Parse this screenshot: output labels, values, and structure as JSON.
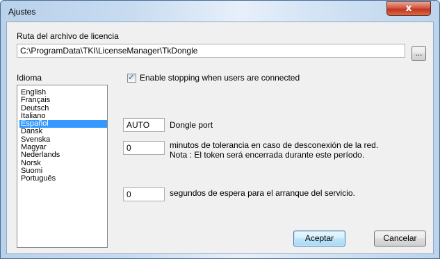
{
  "window": {
    "title": "Ajustes",
    "close_icon": "x-icon",
    "close_label": "x"
  },
  "license": {
    "label": "Ruta del archivo de licencia",
    "path": "C:\\ProgramData\\TKI\\LicenseManager\\TkDongle",
    "browse_label": "..."
  },
  "language": {
    "label": "Idioma",
    "items": [
      "English",
      "Français",
      "Deutsch",
      "Italiano",
      "Español",
      "Dansk",
      "Svenska",
      "Magyar",
      "Nederlands",
      "Norsk",
      "Suomi",
      "Português"
    ],
    "selected": "Español"
  },
  "stopping": {
    "checked": true,
    "label": "Enable stopping when users are connected"
  },
  "dongle": {
    "value": "AUTO",
    "label": "Dongle port"
  },
  "tolerance": {
    "value": "0",
    "line1": "minutos de tolerancia en caso de desconexión de la red.",
    "line2": "Nota : El token será encerrada durante este período."
  },
  "startup": {
    "value": "0",
    "label": "segundos de espera para el arranque del servicio."
  },
  "buttons": {
    "accept": "Aceptar",
    "cancel": "Cancelar"
  }
}
